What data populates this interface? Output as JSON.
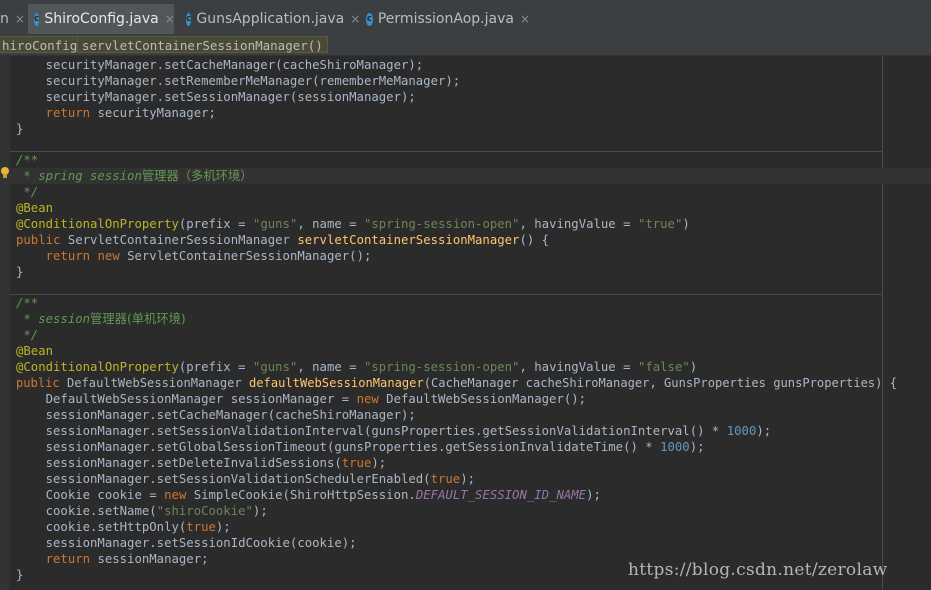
{
  "tabs": [
    {
      "label": "n",
      "icon": "",
      "close": "×",
      "active": false
    },
    {
      "label": "ShiroConfig.java",
      "icon": "class-icon",
      "close": "×",
      "active": true
    },
    {
      "label": "GunsApplication.java",
      "icon": "spring-class-icon",
      "close": "×",
      "active": false
    },
    {
      "label": "PermissionAop.java",
      "icon": "class-icon",
      "close": "×",
      "active": false
    }
  ],
  "breadcrumb": [
    "hiroConfig",
    "servletContainerSessionManager()"
  ],
  "code": {
    "l01": {
      "a": "    securityManager.setCacheManager(cacheShiroManager);"
    },
    "l02": {
      "a": "    securityManager.setRememberMeManager(rememberMeManager);"
    },
    "l03": {
      "a": "    securityManager.setSessionManager(sessionManager);"
    },
    "l04": {
      "kw": "return",
      "a": " securityManager;"
    },
    "l05": {
      "a": "}"
    },
    "l06": {
      "doc": "/**"
    },
    "l07": {
      "doc1": " * spring session",
      "doc2": "管理器（多机环境）"
    },
    "l08": {
      "doc": " */"
    },
    "l09": {
      "ann": "@Bean"
    },
    "l10": {
      "ann": "@ConditionalOnProperty",
      "p1": "(prefix = ",
      "s1": "\"guns\"",
      "p2": ", name = ",
      "s2": "\"spring-session-open\"",
      "p3": ", havingValue = ",
      "s3": "\"true\"",
      "p4": ")"
    },
    "l11": {
      "kw": "public",
      "t": " ServletContainerSessionManager ",
      "fn": "servletContainerSessionManager",
      "e": "() {"
    },
    "l12": {
      "kw1": "return",
      "kw2": "new",
      "a": " ServletContainerSessionManager();"
    },
    "l13": {
      "a": "}"
    },
    "l14": {
      "doc": "/**"
    },
    "l15": {
      "doc1": " * session",
      "doc2": "管理器(单机环境)"
    },
    "l16": {
      "doc": " */"
    },
    "l17": {
      "ann": "@Bean"
    },
    "l18": {
      "ann": "@ConditionalOnProperty",
      "p1": "(prefix = ",
      "s1": "\"guns\"",
      "p2": ", name = ",
      "s2": "\"spring-session-open\"",
      "p3": ", havingValue = ",
      "s3": "\"false\"",
      "p4": ")"
    },
    "l19": {
      "kw": "public",
      "t": " DefaultWebSessionManager ",
      "fn": "defaultWebSessionManager",
      "e": "(CacheManager cacheShiroManager, GunsProperties gunsProperties) {"
    },
    "l20": {
      "a": "    DefaultWebSessionManager sessionManager = ",
      "kw": "new",
      "b": " DefaultWebSessionManager();"
    },
    "l21": {
      "a": "    sessionManager.setCacheManager(cacheShiroManager);"
    },
    "l22": {
      "a": "    sessionManager.setSessionValidationInterval(gunsProperties.getSessionValidationInterval() * ",
      "num": "1000",
      "b": ");"
    },
    "l23": {
      "a": "    sessionManager.setGlobalSessionTimeout(gunsProperties.getSessionInvalidateTime() * ",
      "num": "1000",
      "b": ");"
    },
    "l24": {
      "a": "    sessionManager.setDeleteInvalidSessions(",
      "kw": "true",
      "b": ");"
    },
    "l25": {
      "a": "    sessionManager.setSessionValidationSchedulerEnabled(",
      "kw": "true",
      "b": ");"
    },
    "l26": {
      "a": "    Cookie cookie = ",
      "kw": "new",
      "b": " SimpleCookie(ShiroHttpSession.",
      "c": "DEFAULT_SESSION_ID_NAME",
      "d": ");"
    },
    "l27": {
      "a": "    cookie.setName(",
      "str": "\"shiroCookie\"",
      "b": ");"
    },
    "l28": {
      "a": "    cookie.setHttpOnly(",
      "kw": "true",
      "b": ");"
    },
    "l29": {
      "a": "    sessionManager.setSessionIdCookie(cookie);"
    },
    "l30": {
      "kw": "return",
      "a": " sessionManager;"
    },
    "l31": {
      "a": "}"
    }
  },
  "watermark": "https://blog.csdn.net/zerolaw",
  "colors": {
    "background": "#2b2b2b",
    "keyword": "#cc7832",
    "string": "#6a8759",
    "number": "#6897bb",
    "annotation": "#bbb529",
    "doc_comment": "#629755",
    "method_declaration": "#ffc66d",
    "constant": "#9876aa"
  }
}
